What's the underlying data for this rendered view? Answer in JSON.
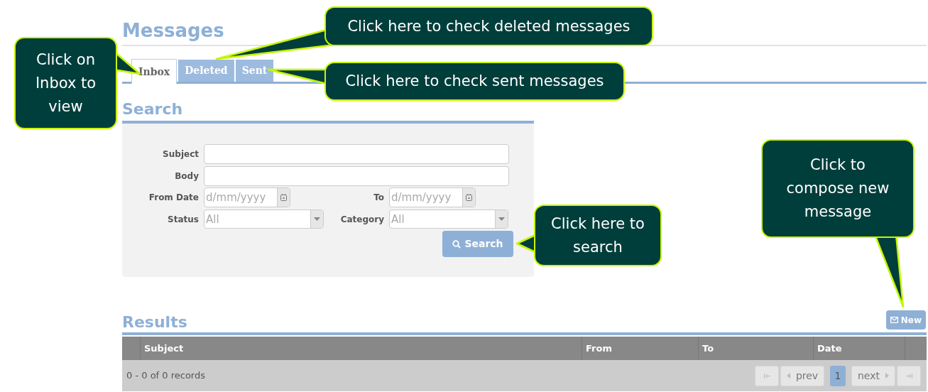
{
  "page": {
    "title": "Messages"
  },
  "tabs": [
    {
      "label": "Inbox",
      "selected": true
    },
    {
      "label": "Deleted",
      "selected": false
    },
    {
      "label": "Sent",
      "selected": false
    }
  ],
  "search": {
    "heading": "Search",
    "text_fields": [
      {
        "label": "Subject"
      },
      {
        "label": "Body"
      }
    ],
    "date_fields": [
      {
        "label": "From Date",
        "placeholder": "d/mm/yyyy"
      },
      {
        "label": "To",
        "placeholder": "d/mm/yyyy"
      }
    ],
    "dropdowns": [
      {
        "label": "Status",
        "value": "All"
      },
      {
        "label": "Category",
        "value": "All"
      }
    ],
    "button": "Search"
  },
  "results": {
    "heading": "Results",
    "new_button": "New",
    "columns": [
      "Subject",
      "From",
      "To",
      "Date"
    ],
    "summary": "0 - 0 of 0 records",
    "pager": [
      {
        "kind": "first"
      },
      {
        "kind": "prev",
        "label": "prev"
      },
      {
        "kind": "page",
        "label": "1",
        "selected": true
      },
      {
        "kind": "next",
        "label": "next"
      },
      {
        "kind": "last"
      }
    ]
  },
  "callouts": [
    {
      "text": "Click on Inbox to view"
    },
    {
      "text": "Click here to check deleted messages"
    },
    {
      "text": "Click here to check sent messages"
    },
    {
      "text": "Click here to search"
    },
    {
      "text": "Click to compose new message"
    }
  ]
}
